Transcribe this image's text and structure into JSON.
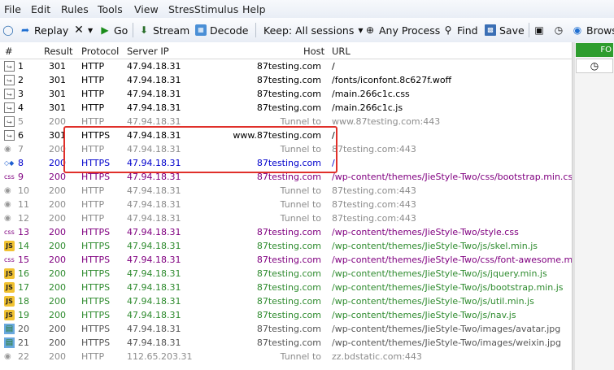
{
  "menu": [
    "File",
    "Edit",
    "Rules",
    "Tools",
    "View",
    "StresStimulus",
    "Help"
  ],
  "toolbar": {
    "replay": "Replay",
    "go": "Go",
    "stream": "Stream",
    "decode": "Decode",
    "keep": "Keep: All sessions",
    "any_process": "Any Process",
    "find": "Find",
    "save": "Save",
    "browse": "Brows"
  },
  "columns": {
    "num": "#",
    "result": "Result",
    "protocol": "Protocol",
    "server_ip": "Server IP",
    "host": "Host",
    "url": "URL"
  },
  "right_panel": {
    "tab": "FO"
  },
  "sessions": [
    {
      "icon": "doc-icon",
      "num": "1",
      "result": "301",
      "protocol": "HTTP",
      "ip": "47.94.18.31",
      "host": "87testing.com",
      "url": "/",
      "color": "#000000"
    },
    {
      "icon": "doc-icon",
      "num": "2",
      "result": "301",
      "protocol": "HTTP",
      "ip": "47.94.18.31",
      "host": "87testing.com",
      "url": "/fonts/iconfont.8c627f.woff",
      "color": "#000000"
    },
    {
      "icon": "doc-icon",
      "num": "3",
      "result": "301",
      "protocol": "HTTP",
      "ip": "47.94.18.31",
      "host": "87testing.com",
      "url": "/main.266c1c.css",
      "color": "#000000"
    },
    {
      "icon": "doc-icon",
      "num": "4",
      "result": "301",
      "protocol": "HTTP",
      "ip": "47.94.18.31",
      "host": "87testing.com",
      "url": "/main.266c1c.js",
      "color": "#000000"
    },
    {
      "icon": "doc-icon",
      "num": "5",
      "result": "200",
      "protocol": "HTTP",
      "ip": "47.94.18.31",
      "host": "Tunnel to",
      "url": "www.87testing.com:443",
      "color": "#8c8c8c"
    },
    {
      "icon": "doc-icon",
      "num": "6",
      "result": "301",
      "protocol": "HTTPS",
      "ip": "47.94.18.31",
      "host": "www.87testing.com",
      "url": "/",
      "color": "#000000"
    },
    {
      "icon": "lock-icon",
      "num": "7",
      "result": "200",
      "protocol": "HTTP",
      "ip": "47.94.18.31",
      "host": "Tunnel to",
      "url": "87testing.com:443",
      "color": "#8c8c8c"
    },
    {
      "icon": "html-icon",
      "num": "8",
      "result": "200",
      "protocol": "HTTPS",
      "ip": "47.94.18.31",
      "host": "87testing.com",
      "url": "/",
      "color": "#0000cc"
    },
    {
      "icon": "css-icon",
      "num": "9",
      "result": "200",
      "protocol": "HTTPS",
      "ip": "47.94.18.31",
      "host": "87testing.com",
      "url": "/wp-content/themes/JieStyle-Two/css/bootstrap.min.css",
      "color": "#800080"
    },
    {
      "icon": "lock-icon",
      "num": "10",
      "result": "200",
      "protocol": "HTTP",
      "ip": "47.94.18.31",
      "host": "Tunnel to",
      "url": "87testing.com:443",
      "color": "#8c8c8c"
    },
    {
      "icon": "lock-icon",
      "num": "11",
      "result": "200",
      "protocol": "HTTP",
      "ip": "47.94.18.31",
      "host": "Tunnel to",
      "url": "87testing.com:443",
      "color": "#8c8c8c"
    },
    {
      "icon": "lock-icon",
      "num": "12",
      "result": "200",
      "protocol": "HTTP",
      "ip": "47.94.18.31",
      "host": "Tunnel to",
      "url": "87testing.com:443",
      "color": "#8c8c8c"
    },
    {
      "icon": "css-icon",
      "num": "13",
      "result": "200",
      "protocol": "HTTPS",
      "ip": "47.94.18.31",
      "host": "87testing.com",
      "url": "/wp-content/themes/JieStyle-Two/style.css",
      "color": "#800080"
    },
    {
      "icon": "js-icon",
      "num": "14",
      "result": "200",
      "protocol": "HTTPS",
      "ip": "47.94.18.31",
      "host": "87testing.com",
      "url": "/wp-content/themes/JieStyle-Two/js/skel.min.js",
      "color": "#2e8b2e"
    },
    {
      "icon": "css-icon",
      "num": "15",
      "result": "200",
      "protocol": "HTTPS",
      "ip": "47.94.18.31",
      "host": "87testing.com",
      "url": "/wp-content/themes/JieStyle-Two/css/font-awesome.min.css",
      "color": "#800080"
    },
    {
      "icon": "js-icon",
      "num": "16",
      "result": "200",
      "protocol": "HTTPS",
      "ip": "47.94.18.31",
      "host": "87testing.com",
      "url": "/wp-content/themes/JieStyle-Two/js/jquery.min.js",
      "color": "#2e8b2e"
    },
    {
      "icon": "js-icon",
      "num": "17",
      "result": "200",
      "protocol": "HTTPS",
      "ip": "47.94.18.31",
      "host": "87testing.com",
      "url": "/wp-content/themes/JieStyle-Two/js/bootstrap.min.js",
      "color": "#2e8b2e"
    },
    {
      "icon": "js-icon",
      "num": "18",
      "result": "200",
      "protocol": "HTTPS",
      "ip": "47.94.18.31",
      "host": "87testing.com",
      "url": "/wp-content/themes/JieStyle-Two/js/util.min.js",
      "color": "#2e8b2e"
    },
    {
      "icon": "js-icon",
      "num": "19",
      "result": "200",
      "protocol": "HTTPS",
      "ip": "47.94.18.31",
      "host": "87testing.com",
      "url": "/wp-content/themes/JieStyle-Two/js/nav.js",
      "color": "#2e8b2e"
    },
    {
      "icon": "image-icon",
      "num": "20",
      "result": "200",
      "protocol": "HTTPS",
      "ip": "47.94.18.31",
      "host": "87testing.com",
      "url": "/wp-content/themes/JieStyle-Two/images/avatar.jpg",
      "color": "#555555"
    },
    {
      "icon": "image-icon",
      "num": "21",
      "result": "200",
      "protocol": "HTTPS",
      "ip": "47.94.18.31",
      "host": "87testing.com",
      "url": "/wp-content/themes/JieStyle-Two/images/weixin.jpg",
      "color": "#555555"
    },
    {
      "icon": "lock-icon",
      "num": "22",
      "result": "200",
      "protocol": "HTTP",
      "ip": "112.65.203.31",
      "host": "Tunnel to",
      "url": "zz.bdstatic.com:443",
      "color": "#8c8c8c"
    }
  ]
}
